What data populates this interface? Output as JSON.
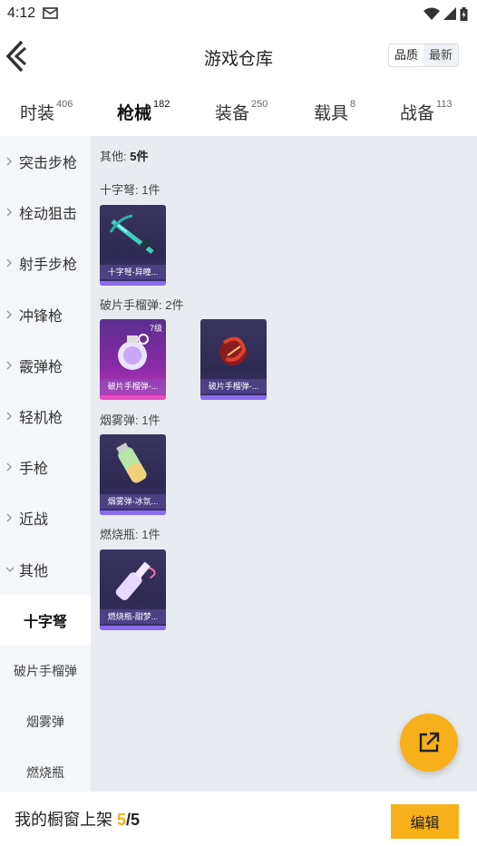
{
  "status": {
    "time": "4:12"
  },
  "header": {
    "title": "游戏仓库",
    "sort_options": [
      "品质",
      "最新"
    ]
  },
  "tabs": [
    {
      "label": "时装",
      "count": "406"
    },
    {
      "label": "枪械",
      "count": "182",
      "active": true
    },
    {
      "label": "装备",
      "count": "250"
    },
    {
      "label": "载具",
      "count": "8"
    },
    {
      "label": "战备",
      "count": "113"
    }
  ],
  "sidebar": {
    "categories": [
      "突击步枪",
      "栓动狙击",
      "射手步枪",
      "冲锋枪",
      "霰弹枪",
      "轻机枪",
      "手枪",
      "近战",
      "其他"
    ],
    "sub_items": [
      "十字弩",
      "破片手榴弹",
      "烟雾弹",
      "燃烧瓶"
    ]
  },
  "main": {
    "total": {
      "label": "其他:",
      "count": "5件"
    },
    "sections": [
      {
        "label": "十字弩:",
        "count": "1件",
        "items": [
          {
            "name": "十字弩-异瞳...",
            "level": ""
          }
        ]
      },
      {
        "label": "破片手榴弹:",
        "count": "2件",
        "items": [
          {
            "name": "破片手榴弹-...",
            "level": "7级"
          },
          {
            "name": "破片手榴弹-...",
            "level": ""
          }
        ]
      },
      {
        "label": "烟雾弹:",
        "count": "1件",
        "items": [
          {
            "name": "烟雾弹-冰氛...",
            "level": ""
          }
        ]
      },
      {
        "label": "燃烧瓶:",
        "count": "1件",
        "items": [
          {
            "name": "燃烧瓶-甜梦...",
            "level": ""
          }
        ]
      }
    ]
  },
  "bottom": {
    "shelf_label": "我的橱窗上架",
    "shelf_current": "5",
    "shelf_total": "/5",
    "edit_label": "编辑"
  },
  "colors": {
    "accent": "#f7b01a",
    "rare_purple": "#8a6cf0",
    "epic_pink": "#e64bc2"
  }
}
